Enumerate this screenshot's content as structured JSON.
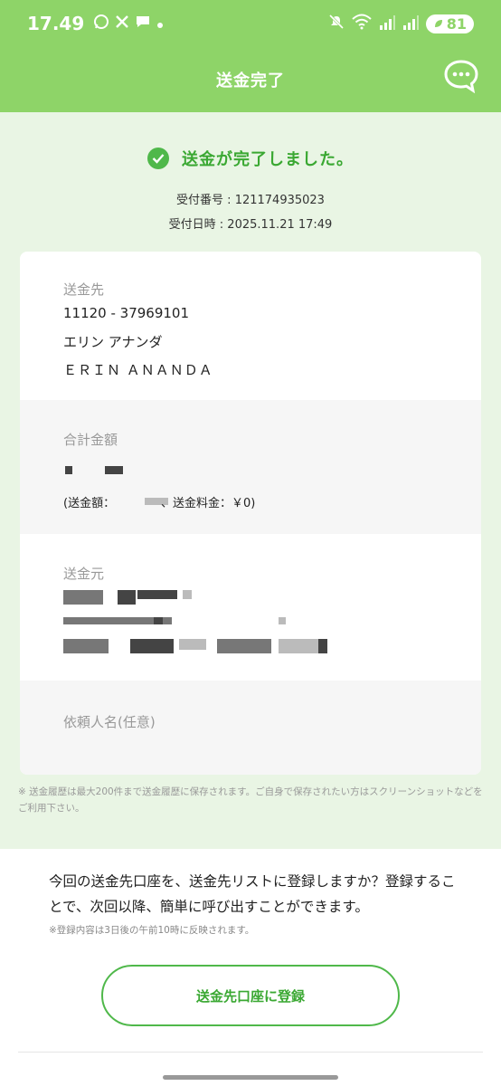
{
  "status": {
    "time": "17.49",
    "battery": "81",
    "icons": [
      "whatsapp-icon",
      "x-icon",
      "message-icon",
      "dot-icon",
      "mute-icon",
      "wifi-icon",
      "signal-icon",
      "signal-icon",
      "battery-icon"
    ]
  },
  "header": {
    "title": "送金完了",
    "chat_icon": "chat-bubble-icon"
  },
  "result": {
    "message": "送金が完了しました。",
    "receipt_no": "受付番号 : 121174935023",
    "receipt_datetime": "受付日時 : 2025.11.21 17:49"
  },
  "recipient": {
    "label": "送金先",
    "account": "11120 - 37969101",
    "name_kana": "エリン アナンダ",
    "name_alpha": "ＥＲＩＮ ＡＮＡＮＤＡ"
  },
  "amount": {
    "label": "合計金額",
    "breakdown_prefix": "(送金額：",
    "breakdown_suffix": "、送金料金：￥0)"
  },
  "sender": {
    "label": "送金元"
  },
  "requester": {
    "label": "依頼人名(任意)"
  },
  "history_note": "※ 送金履歴は最大200件まで送金履歴に保存されます。ご自身で保存されたい方はスクリーンショットなどをご利用下さい。",
  "register": {
    "prompt": "今回の送金先口座を、送金先リストに登録しますか？登録することで、次回以降、簡単に呼び出すことができます。",
    "note": "※登録内容は3日後の午前10時に反映されます。",
    "button_label": "送金先口座に登録"
  }
}
